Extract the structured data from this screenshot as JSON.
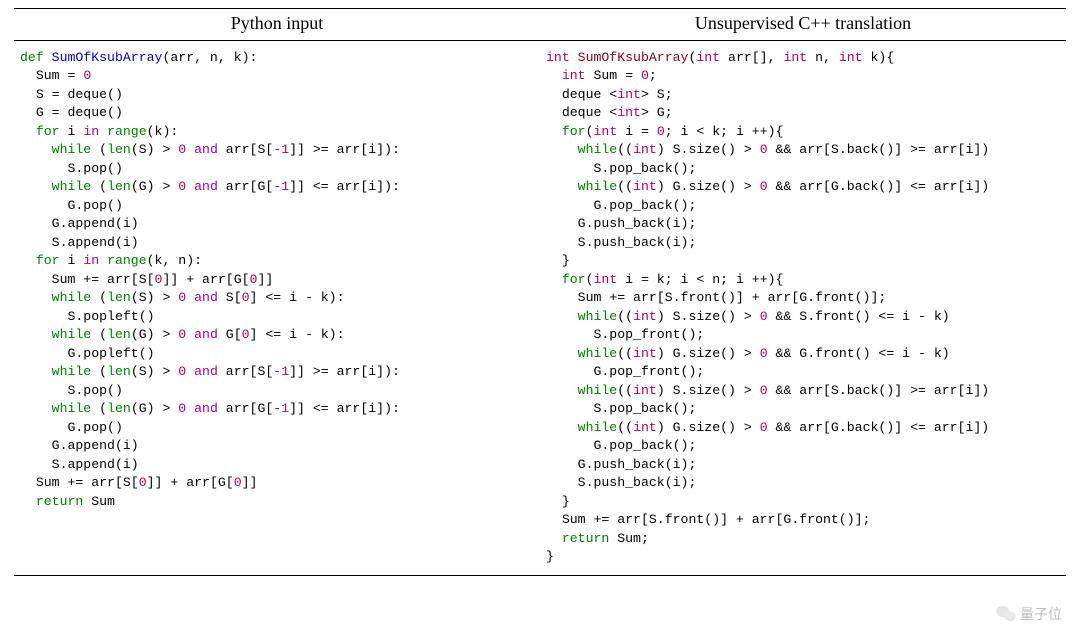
{
  "header": {
    "left": "Python input",
    "right": "Unsupervised C++ translation"
  },
  "watermark": "量子位",
  "python_code": [
    [
      [
        "kw-green",
        "def "
      ],
      [
        "fn-blue",
        "SumOfKsubArray"
      ],
      [
        "",
        "(arr, n, k):"
      ]
    ],
    [
      [
        "",
        "  Sum = "
      ],
      [
        "kw-mag",
        "0"
      ]
    ],
    [
      [
        "",
        "  S = deque()"
      ]
    ],
    [
      [
        "",
        "  G = deque()"
      ]
    ],
    [
      [
        "",
        "  "
      ],
      [
        "kw-green",
        "for "
      ],
      [
        "",
        "i "
      ],
      [
        "kw-purple",
        "in "
      ],
      [
        "kw-green",
        "range"
      ],
      [
        "",
        "(k):"
      ]
    ],
    [
      [
        "",
        "    "
      ],
      [
        "kw-green",
        "while "
      ],
      [
        "",
        "("
      ],
      [
        "kw-green",
        "len"
      ],
      [
        "",
        "(S) > "
      ],
      [
        "kw-mag",
        "0"
      ],
      [
        "",
        " "
      ],
      [
        "kw-purple",
        "and "
      ],
      [
        "",
        "arr[S["
      ],
      [
        "kw-mag",
        "-1"
      ],
      [
        "",
        "]] >= arr[i]):"
      ]
    ],
    [
      [
        "",
        "      S.pop()"
      ]
    ],
    [
      [
        "",
        "    "
      ],
      [
        "kw-green",
        "while "
      ],
      [
        "",
        "("
      ],
      [
        "kw-green",
        "len"
      ],
      [
        "",
        "(G) > "
      ],
      [
        "kw-mag",
        "0"
      ],
      [
        "",
        " "
      ],
      [
        "kw-purple",
        "and "
      ],
      [
        "",
        "arr[G["
      ],
      [
        "kw-mag",
        "-1"
      ],
      [
        "",
        "]] <= arr[i]):"
      ]
    ],
    [
      [
        "",
        "      G.pop()"
      ]
    ],
    [
      [
        "",
        "    G.append(i)"
      ]
    ],
    [
      [
        "",
        "    S.append(i)"
      ]
    ],
    [
      [
        "",
        "  "
      ],
      [
        "kw-green",
        "for "
      ],
      [
        "",
        "i "
      ],
      [
        "kw-purple",
        "in "
      ],
      [
        "kw-green",
        "range"
      ],
      [
        "",
        "(k, n):"
      ]
    ],
    [
      [
        "",
        "    Sum += arr[S["
      ],
      [
        "kw-mag",
        "0"
      ],
      [
        "",
        "]] + arr[G["
      ],
      [
        "kw-mag",
        "0"
      ],
      [
        "",
        "]]"
      ]
    ],
    [
      [
        "",
        "    "
      ],
      [
        "kw-green",
        "while "
      ],
      [
        "",
        "("
      ],
      [
        "kw-green",
        "len"
      ],
      [
        "",
        "(S) > "
      ],
      [
        "kw-mag",
        "0"
      ],
      [
        "",
        " "
      ],
      [
        "kw-purple",
        "and "
      ],
      [
        "",
        "S["
      ],
      [
        "kw-mag",
        "0"
      ],
      [
        "",
        "] <= i - k):"
      ]
    ],
    [
      [
        "",
        "      S.popleft()"
      ]
    ],
    [
      [
        "",
        "    "
      ],
      [
        "kw-green",
        "while "
      ],
      [
        "",
        "("
      ],
      [
        "kw-green",
        "len"
      ],
      [
        "",
        "(G) > "
      ],
      [
        "kw-mag",
        "0"
      ],
      [
        "",
        " "
      ],
      [
        "kw-purple",
        "and "
      ],
      [
        "",
        "G["
      ],
      [
        "kw-mag",
        "0"
      ],
      [
        "",
        "] <= i - k):"
      ]
    ],
    [
      [
        "",
        "      G.popleft()"
      ]
    ],
    [
      [
        "",
        "    "
      ],
      [
        "kw-green",
        "while "
      ],
      [
        "",
        "("
      ],
      [
        "kw-green",
        "len"
      ],
      [
        "",
        "(S) > "
      ],
      [
        "kw-mag",
        "0"
      ],
      [
        "",
        " "
      ],
      [
        "kw-purple",
        "and "
      ],
      [
        "",
        "arr[S["
      ],
      [
        "kw-mag",
        "-1"
      ],
      [
        "",
        "]] >= arr[i]):"
      ]
    ],
    [
      [
        "",
        "      S.pop()"
      ]
    ],
    [
      [
        "",
        "    "
      ],
      [
        "kw-green",
        "while "
      ],
      [
        "",
        "("
      ],
      [
        "kw-green",
        "len"
      ],
      [
        "",
        "(G) > "
      ],
      [
        "kw-mag",
        "0"
      ],
      [
        "",
        " "
      ],
      [
        "kw-purple",
        "and "
      ],
      [
        "",
        "arr[G["
      ],
      [
        "kw-mag",
        "-1"
      ],
      [
        "",
        "]] <= arr[i]):"
      ]
    ],
    [
      [
        "",
        "      G.pop()"
      ]
    ],
    [
      [
        "",
        "    G.append(i)"
      ]
    ],
    [
      [
        "",
        "    S.append(i)"
      ]
    ],
    [
      [
        "",
        "  Sum += arr[S["
      ],
      [
        "kw-mag",
        "0"
      ],
      [
        "",
        "]] + arr[G["
      ],
      [
        "kw-mag",
        "0"
      ],
      [
        "",
        "]]"
      ]
    ],
    [
      [
        "",
        "  "
      ],
      [
        "kw-green",
        "return "
      ],
      [
        "",
        "Sum"
      ]
    ]
  ],
  "cpp_code": [
    [
      [
        "type-red",
        "int "
      ],
      [
        "fn-dkred",
        "SumOfKsubArray"
      ],
      [
        "",
        "("
      ],
      [
        "type-red",
        "int "
      ],
      [
        "",
        "arr[], "
      ],
      [
        "type-red",
        "int "
      ],
      [
        "",
        "n, "
      ],
      [
        "type-red",
        "int "
      ],
      [
        "",
        "k){"
      ]
    ],
    [
      [
        "",
        "  "
      ],
      [
        "type-red",
        "int "
      ],
      [
        "",
        "Sum = "
      ],
      [
        "kw-mag",
        "0"
      ],
      [
        "",
        ";"
      ]
    ],
    [
      [
        "",
        "  deque <"
      ],
      [
        "type-red",
        "int"
      ],
      [
        "",
        "> S;"
      ]
    ],
    [
      [
        "",
        "  deque <"
      ],
      [
        "type-red",
        "int"
      ],
      [
        "",
        "> G;"
      ]
    ],
    [
      [
        "",
        "  "
      ],
      [
        "c-green",
        "for"
      ],
      [
        "",
        "("
      ],
      [
        "type-red",
        "int "
      ],
      [
        "",
        "i = "
      ],
      [
        "kw-mag",
        "0"
      ],
      [
        "",
        "; i < k; i ++){"
      ]
    ],
    [
      [
        "",
        "    "
      ],
      [
        "c-green",
        "while"
      ],
      [
        "",
        "(("
      ],
      [
        "type-red",
        "int"
      ],
      [
        "",
        ") S.size() > "
      ],
      [
        "kw-mag",
        "0"
      ],
      [
        "",
        " && arr[S.back()] >= arr[i])"
      ]
    ],
    [
      [
        "",
        "      S.pop_back();"
      ]
    ],
    [
      [
        "",
        "    "
      ],
      [
        "c-green",
        "while"
      ],
      [
        "",
        "(("
      ],
      [
        "type-red",
        "int"
      ],
      [
        "",
        ") G.size() > "
      ],
      [
        "kw-mag",
        "0"
      ],
      [
        "",
        " && arr[G.back()] <= arr[i])"
      ]
    ],
    [
      [
        "",
        "      G.pop_back();"
      ]
    ],
    [
      [
        "",
        "    G.push_back(i);"
      ]
    ],
    [
      [
        "",
        "    S.push_back(i);"
      ]
    ],
    [
      [
        "",
        "  }"
      ]
    ],
    [
      [
        "",
        "  "
      ],
      [
        "c-green",
        "for"
      ],
      [
        "",
        "("
      ],
      [
        "type-red",
        "int "
      ],
      [
        "",
        "i = k; i < n; i ++){"
      ]
    ],
    [
      [
        "",
        "    Sum += arr[S.front()] + arr[G.front()];"
      ]
    ],
    [
      [
        "",
        "    "
      ],
      [
        "c-green",
        "while"
      ],
      [
        "",
        "(("
      ],
      [
        "type-red",
        "int"
      ],
      [
        "",
        ") S.size() > "
      ],
      [
        "kw-mag",
        "0"
      ],
      [
        "",
        " && S.front() <= i - k)"
      ]
    ],
    [
      [
        "",
        "      S.pop_front();"
      ]
    ],
    [
      [
        "",
        "    "
      ],
      [
        "c-green",
        "while"
      ],
      [
        "",
        "(("
      ],
      [
        "type-red",
        "int"
      ],
      [
        "",
        ") G.size() > "
      ],
      [
        "kw-mag",
        "0"
      ],
      [
        "",
        " && G.front() <= i - k)"
      ]
    ],
    [
      [
        "",
        "      G.pop_front();"
      ]
    ],
    [
      [
        "",
        "    "
      ],
      [
        "c-green",
        "while"
      ],
      [
        "",
        "(("
      ],
      [
        "type-red",
        "int"
      ],
      [
        "",
        ") S.size() > "
      ],
      [
        "kw-mag",
        "0"
      ],
      [
        "",
        " && arr[S.back()] >= arr[i])"
      ]
    ],
    [
      [
        "",
        "      S.pop_back();"
      ]
    ],
    [
      [
        "",
        "    "
      ],
      [
        "c-green",
        "while"
      ],
      [
        "",
        "(("
      ],
      [
        "type-red",
        "int"
      ],
      [
        "",
        ") G.size() > "
      ],
      [
        "kw-mag",
        "0"
      ],
      [
        "",
        " && arr[G.back()] <= arr[i])"
      ]
    ],
    [
      [
        "",
        "      G.pop_back();"
      ]
    ],
    [
      [
        "",
        "    G.push_back(i);"
      ]
    ],
    [
      [
        "",
        "    S.push_back(i);"
      ]
    ],
    [
      [
        "",
        "  }"
      ]
    ],
    [
      [
        "",
        "  Sum += arr[S.front()] + arr[G.front()];"
      ]
    ],
    [
      [
        "",
        "  "
      ],
      [
        "c-green",
        "return "
      ],
      [
        "",
        "Sum;"
      ]
    ],
    [
      [
        "",
        "}"
      ]
    ]
  ]
}
